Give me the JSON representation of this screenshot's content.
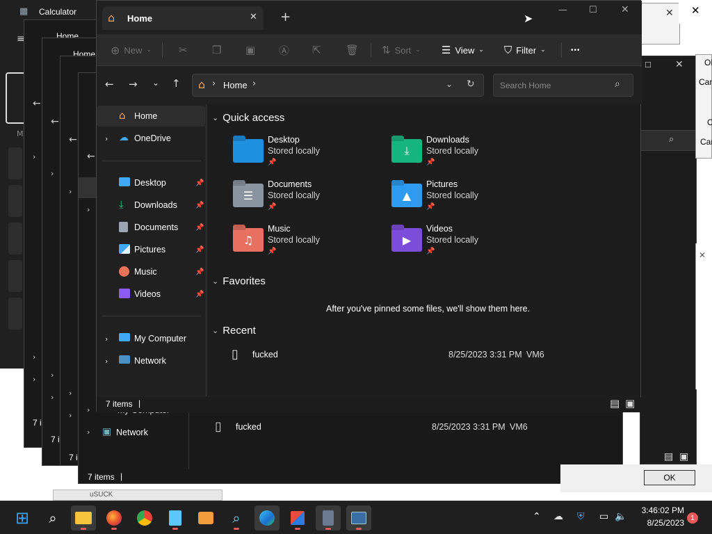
{
  "calculator": {
    "title": "Calculator"
  },
  "bg_windows": {
    "stack_title": "Home",
    "status_prefix": "7 i",
    "second_window": {
      "nav_computer": "My Computer",
      "nav_network": "Network",
      "recent_file": "fucked",
      "recent_date": "8/25/2023 3:31 PM",
      "recent_owner": "VM6",
      "status": "7 items"
    },
    "right_buttons": [
      "OK",
      "Canc",
      "O",
      "Can"
    ],
    "ok_button": "OK",
    "bottom_label": "uSUCK"
  },
  "explorer": {
    "tab_title": "Home",
    "toolbar": {
      "new": "New",
      "sort": "Sort",
      "view": "View",
      "filter": "Filter",
      "more": "•••"
    },
    "address": {
      "location": "Home",
      "separator": "›"
    },
    "search": {
      "placeholder": "Search Home"
    },
    "nav": {
      "home": "Home",
      "onedrive": "OneDrive",
      "pinned": [
        {
          "label": "Desktop",
          "icon": "desktop-icon",
          "color": "#3fa9f5"
        },
        {
          "label": "Downloads",
          "icon": "downloads-icon",
          "color": "#21c27a"
        },
        {
          "label": "Documents",
          "icon": "documents-icon",
          "color": "#9aa5b1"
        },
        {
          "label": "Pictures",
          "icon": "pictures-icon",
          "color": "#3fa9f5"
        },
        {
          "label": "Music",
          "icon": "music-icon",
          "color": "#e8735c"
        },
        {
          "label": "Videos",
          "icon": "videos-icon",
          "color": "#8b5cf6"
        }
      ],
      "my_computer": "My Computer",
      "network": "Network"
    },
    "quick_access": {
      "title": "Quick access",
      "items": [
        {
          "name": "Desktop",
          "sub": "Stored locally",
          "color": "#1e90e0"
        },
        {
          "name": "Downloads",
          "sub": "Stored locally",
          "color": "#16b47f"
        },
        {
          "name": "Documents",
          "sub": "Stored locally",
          "color": "#8a94a0"
        },
        {
          "name": "Pictures",
          "sub": "Stored locally",
          "color": "#2d9cf0"
        },
        {
          "name": "Music",
          "sub": "Stored locally",
          "color": "#e87060"
        },
        {
          "name": "Videos",
          "sub": "Stored locally",
          "color": "#7c4ddb"
        }
      ]
    },
    "favorites": {
      "title": "Favorites",
      "empty": "After you've pinned some files, we'll show them here."
    },
    "recent": {
      "title": "Recent",
      "items": [
        {
          "name": "fucked",
          "date": "8/25/2023 3:31 PM",
          "owner": "VM6"
        }
      ]
    },
    "status": {
      "count": "7 items"
    }
  },
  "taskbar": {
    "clock_time": "3:46:02 PM",
    "clock_date": "8/25/2023",
    "notification_count": "1"
  }
}
